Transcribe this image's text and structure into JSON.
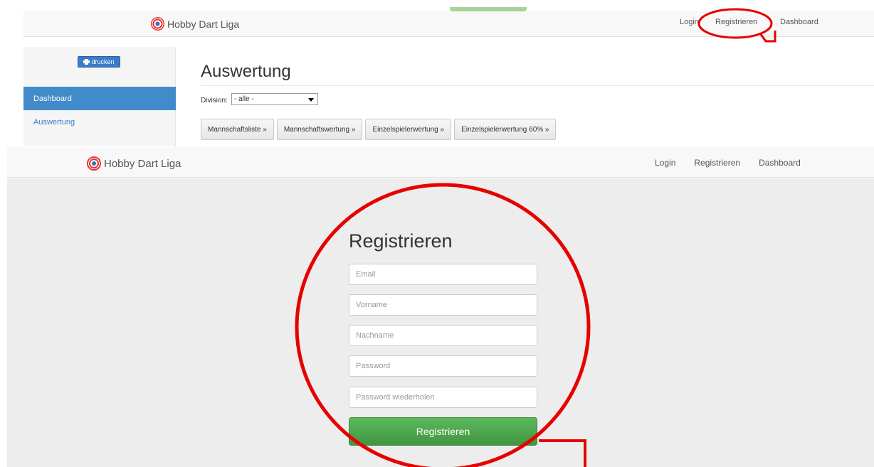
{
  "top_page": {
    "brand": "Hobby Dart Liga",
    "nav_links": [
      "Login",
      "Registrieren",
      "Dashboard"
    ],
    "print_button": "drucken",
    "sidebar_items": [
      "Dashboard",
      "Auswertung"
    ],
    "heading": "Auswertung",
    "division_label": "Division:",
    "division_value": "- alle -",
    "tabs": [
      "Mannschaftsliste »",
      "Mannschaftswertung »",
      "Einzelspielerwertung »",
      "Einzelspielerwertung 60% »"
    ]
  },
  "reg_page": {
    "brand": "Hobby Dart Liga",
    "nav_links": [
      "Login",
      "Registrieren",
      "Dashboard"
    ],
    "title": "Registrieren",
    "fields": {
      "email": "Email",
      "vorname": "Vorname",
      "nachname": "Nachname",
      "password": "Password",
      "password_repeat": "Password wiederholen"
    },
    "submit_label": "Registrieren"
  },
  "colors": {
    "annotation": "#e60000",
    "primary": "#428bca",
    "success": "#5cb85c"
  },
  "icons": [
    "dart-logo-icon",
    "print-icon",
    "select-caret-icon"
  ]
}
